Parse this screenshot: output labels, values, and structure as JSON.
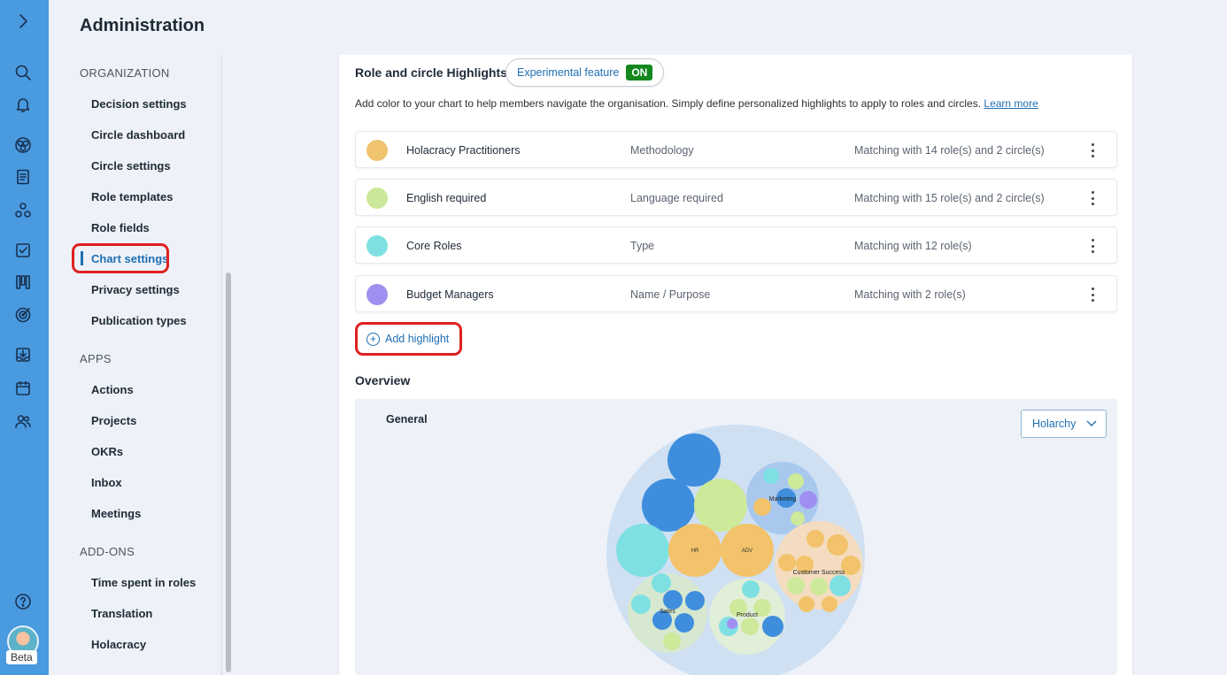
{
  "rail": {
    "icons": [
      "expand-chevron-icon",
      "search-icon",
      "bell-icon",
      "chart-icon",
      "document-icon",
      "circles-icon",
      "checkbox-icon",
      "kanban-icon",
      "target-icon",
      "inbox-icon",
      "calendar-icon",
      "users-icon",
      "help-icon"
    ],
    "beta_label": "Beta"
  },
  "header": {
    "title": "Administration"
  },
  "nav": {
    "sections": [
      {
        "title": "ORGANIZATION",
        "items": [
          "Decision settings",
          "Circle dashboard",
          "Circle settings",
          "Role templates",
          "Role fields",
          "Chart settings",
          "Privacy settings",
          "Publication types"
        ]
      },
      {
        "title": "APPS",
        "items": [
          "Actions",
          "Projects",
          "OKRs",
          "Inbox",
          "Meetings"
        ]
      },
      {
        "title": "ADD-ONS",
        "items": [
          "Time spent in roles",
          "Translation",
          "Holacracy"
        ]
      }
    ],
    "active": "Chart settings"
  },
  "highlights": {
    "title": "Role and circle Highlights",
    "experimental_label": "Experimental feature",
    "toggle_label": "ON",
    "description": "Add color to your chart to help members navigate the organisation. Simply define personalized highlights to apply to roles and circles.",
    "learn_more": "Learn more",
    "rows": [
      {
        "name": "Holacracy Practitioners",
        "criteria": "Methodology",
        "match": "Matching with 14 role(s) and 2 circle(s)",
        "color": "#f0c36e"
      },
      {
        "name": "English required",
        "criteria": "Language required",
        "match": "Matching with 15 role(s) and 2 circle(s)",
        "color": "#cbe89a"
      },
      {
        "name": "Core Roles",
        "criteria": "Type",
        "match": "Matching with 12 role(s)",
        "color": "#7ee0e2"
      },
      {
        "name": "Budget Managers",
        "criteria": "Name / Purpose",
        "match": "Matching with 2 role(s)",
        "color": "#a08ff0"
      }
    ],
    "add_label": "Add highlight"
  },
  "overview": {
    "title": "Overview",
    "circle_name": "General",
    "view_select": "Holarchy",
    "labels": {
      "marketing": "Marketing",
      "customer_success": "Customer Success",
      "sales": "Sales",
      "product": "Product",
      "hr": "HR",
      "adv": "ADV"
    }
  }
}
